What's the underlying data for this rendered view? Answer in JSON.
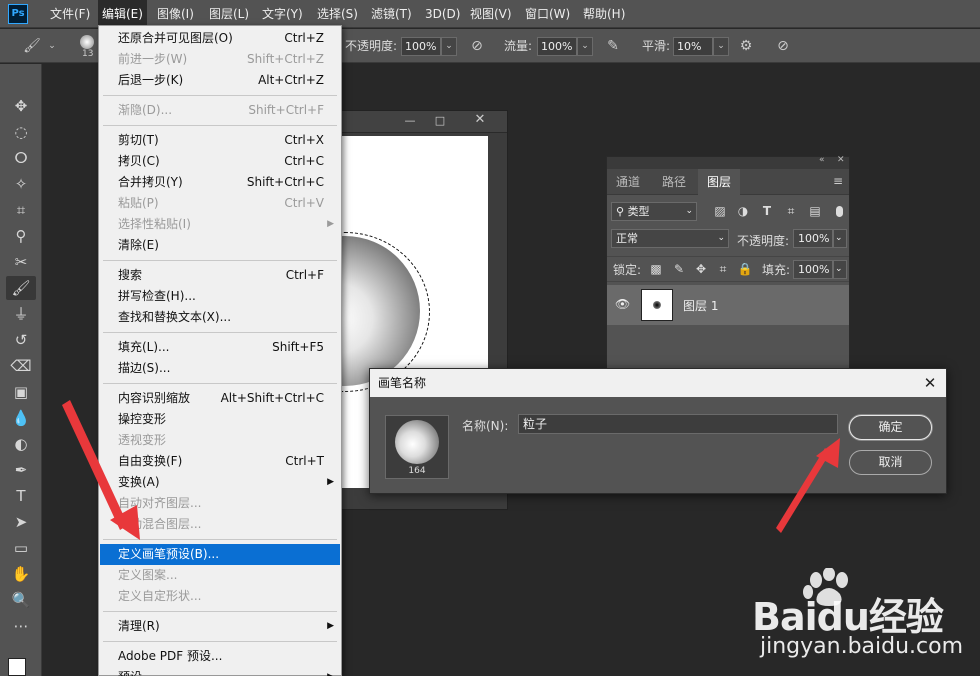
{
  "app": {
    "logo": "Ps"
  },
  "menubar": [
    "文件(F)",
    "编辑(E)",
    "图像(I)",
    "图层(L)",
    "文字(Y)",
    "选择(S)",
    "滤镜(T)",
    "3D(D)",
    "视图(V)",
    "窗口(W)",
    "帮助(H)"
  ],
  "options": {
    "brush_size": "13",
    "opacity_label": "不透明度:",
    "opacity_value": "100%",
    "flow_label": "流量:",
    "flow_value": "100%",
    "smooth_label": "平滑:",
    "smooth_value": "10%"
  },
  "edit_menu": [
    {
      "label": "还原合并可见图层(O)",
      "shortcut": "Ctrl+Z",
      "enabled": true
    },
    {
      "label": "前进一步(W)",
      "shortcut": "Shift+Ctrl+Z",
      "enabled": false
    },
    {
      "label": "后退一步(K)",
      "shortcut": "Alt+Ctrl+Z",
      "enabled": true
    },
    {
      "sep": true
    },
    {
      "label": "渐隐(D)...",
      "shortcut": "Shift+Ctrl+F",
      "enabled": false
    },
    {
      "sep": true
    },
    {
      "label": "剪切(T)",
      "shortcut": "Ctrl+X",
      "enabled": true
    },
    {
      "label": "拷贝(C)",
      "shortcut": "Ctrl+C",
      "enabled": true
    },
    {
      "label": "合并拷贝(Y)",
      "shortcut": "Shift+Ctrl+C",
      "enabled": true
    },
    {
      "label": "粘贴(P)",
      "shortcut": "Ctrl+V",
      "enabled": false
    },
    {
      "label": "选择性粘贴(I)",
      "shortcut": "",
      "enabled": false,
      "submenu": true
    },
    {
      "label": "清除(E)",
      "shortcut": "",
      "enabled": true
    },
    {
      "sep": true
    },
    {
      "label": "搜索",
      "shortcut": "Ctrl+F",
      "enabled": true
    },
    {
      "label": "拼写检查(H)...",
      "shortcut": "",
      "enabled": true
    },
    {
      "label": "查找和替换文本(X)...",
      "shortcut": "",
      "enabled": true
    },
    {
      "sep": true
    },
    {
      "label": "填充(L)...",
      "shortcut": "Shift+F5",
      "enabled": true
    },
    {
      "label": "描边(S)...",
      "shortcut": "",
      "enabled": true
    },
    {
      "sep": true
    },
    {
      "label": "内容识别缩放",
      "shortcut": "Alt+Shift+Ctrl+C",
      "enabled": true
    },
    {
      "label": "操控变形",
      "shortcut": "",
      "enabled": true
    },
    {
      "label": "透视变形",
      "shortcut": "",
      "enabled": false
    },
    {
      "label": "自由变换(F)",
      "shortcut": "Ctrl+T",
      "enabled": true
    },
    {
      "label": "变换(A)",
      "shortcut": "",
      "enabled": true,
      "submenu": true
    },
    {
      "label": "自动对齐图层...",
      "shortcut": "",
      "enabled": false
    },
    {
      "label": "自动混合图层...",
      "shortcut": "",
      "enabled": false
    },
    {
      "sep": true
    },
    {
      "label": "定义画笔预设(B)...",
      "shortcut": "",
      "enabled": true,
      "highlight": true
    },
    {
      "label": "定义图案...",
      "shortcut": "",
      "enabled": false
    },
    {
      "label": "定义自定形状...",
      "shortcut": "",
      "enabled": false
    },
    {
      "sep": true
    },
    {
      "label": "清理(R)",
      "shortcut": "",
      "enabled": true,
      "submenu": true
    },
    {
      "sep": true
    },
    {
      "label": "Adobe PDF 预设...",
      "shortcut": "",
      "enabled": true
    },
    {
      "label": "预设",
      "shortcut": "",
      "enabled": true,
      "submenu": true
    }
  ],
  "layers_panel": {
    "tabs": [
      "通道",
      "路径",
      "图层"
    ],
    "filter_label": "类型",
    "blend_mode": "正常",
    "opacity_label": "不透明度:",
    "opacity_value": "100%",
    "lock_label": "锁定:",
    "fill_label": "填充:",
    "fill_value": "100%",
    "layer_name": "图层 1"
  },
  "dialog": {
    "title": "画笔名称",
    "name_label": "名称(N):",
    "name_value": "粒子",
    "brush_size": "164",
    "ok_label": "确定",
    "cancel_label": "取消"
  },
  "watermark": {
    "brand": "Baidu经验",
    "url": "jingyan.baidu.com"
  },
  "colors": {
    "highlight": "#0a6fd3",
    "arrow": "#e8383b",
    "ui_gray": "#535353"
  }
}
